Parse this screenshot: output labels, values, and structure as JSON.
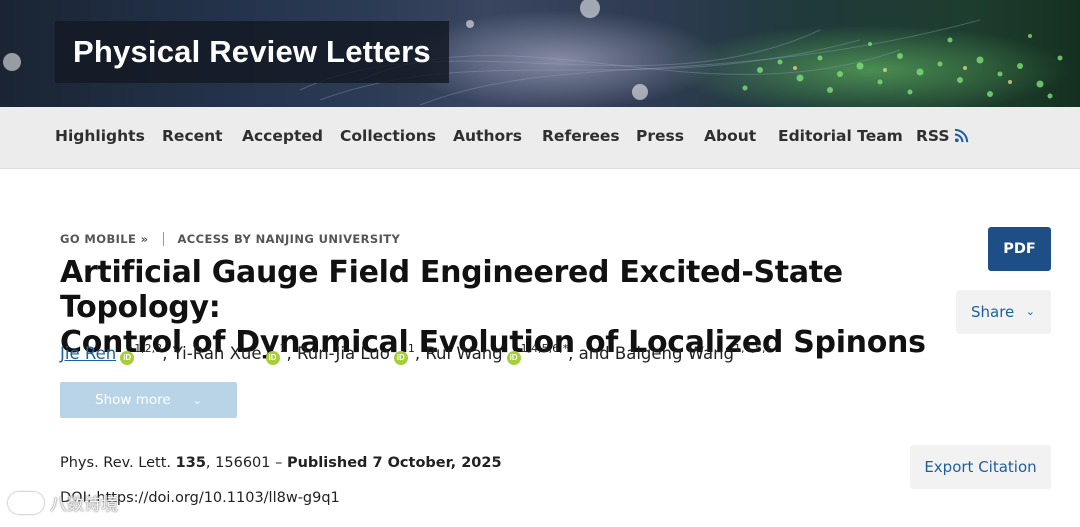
{
  "header": {
    "journal_title": "Physical Review Letters"
  },
  "nav": {
    "items": [
      {
        "label": "Highlights"
      },
      {
        "label": "Recent"
      },
      {
        "label": "Accepted"
      },
      {
        "label": "Collections"
      },
      {
        "label": "Authors"
      },
      {
        "label": "Referees"
      },
      {
        "label": "Press"
      },
      {
        "label": "About"
      },
      {
        "label": "Editorial Team"
      },
      {
        "label": "RSS"
      }
    ],
    "rss_icon": "rss-icon"
  },
  "meta": {
    "go_mobile": "GO MOBILE »",
    "access": "ACCESS BY NANJING UNIVERSITY"
  },
  "article": {
    "title_line1": "Artificial Gauge Field Engineered Excited-State Topology:",
    "title_line2": "Control of Dynamical Evolution of Localized Spinons",
    "authors": [
      {
        "name": "Jie Ren",
        "affil": "1,2,3",
        "orcid": true,
        "link": true,
        "sep": ", "
      },
      {
        "name": "Yi-Ran Xue",
        "affil": "1",
        "orcid": true,
        "link": false,
        "sep": ", "
      },
      {
        "name": "Run-Jia Luo",
        "affil": "1",
        "orcid": true,
        "link": false,
        "sep": ", "
      },
      {
        "name": "Rui Wang",
        "affil": "1,4,5,6,*",
        "orcid": true,
        "link": false,
        "sep": ", and "
      },
      {
        "name": "Baigeng Wang",
        "affil": "1,4,5,†",
        "orcid": false,
        "link": false,
        "sep": ""
      }
    ],
    "orcid_label": "iD",
    "show_more": "Show more",
    "citation": {
      "journal": "Phys. Rev. Lett.",
      "volume": "135",
      "article_no": ", 156601 – ",
      "published": "Published 7 October, 2025"
    },
    "doi": "DOI: https://doi.org/10.1103/ll8w-g9q1"
  },
  "actions": {
    "pdf": "PDF",
    "share": "Share",
    "export_citation": "Export Citation"
  },
  "watermark": {
    "text": "八数诗境"
  },
  "colors": {
    "nav_bg": "#ececec",
    "pdf_bg": "#1d4f86",
    "link": "#1f5fa0",
    "orcid": "#a6ce39",
    "show_more_bg": "#b9d4e6"
  }
}
